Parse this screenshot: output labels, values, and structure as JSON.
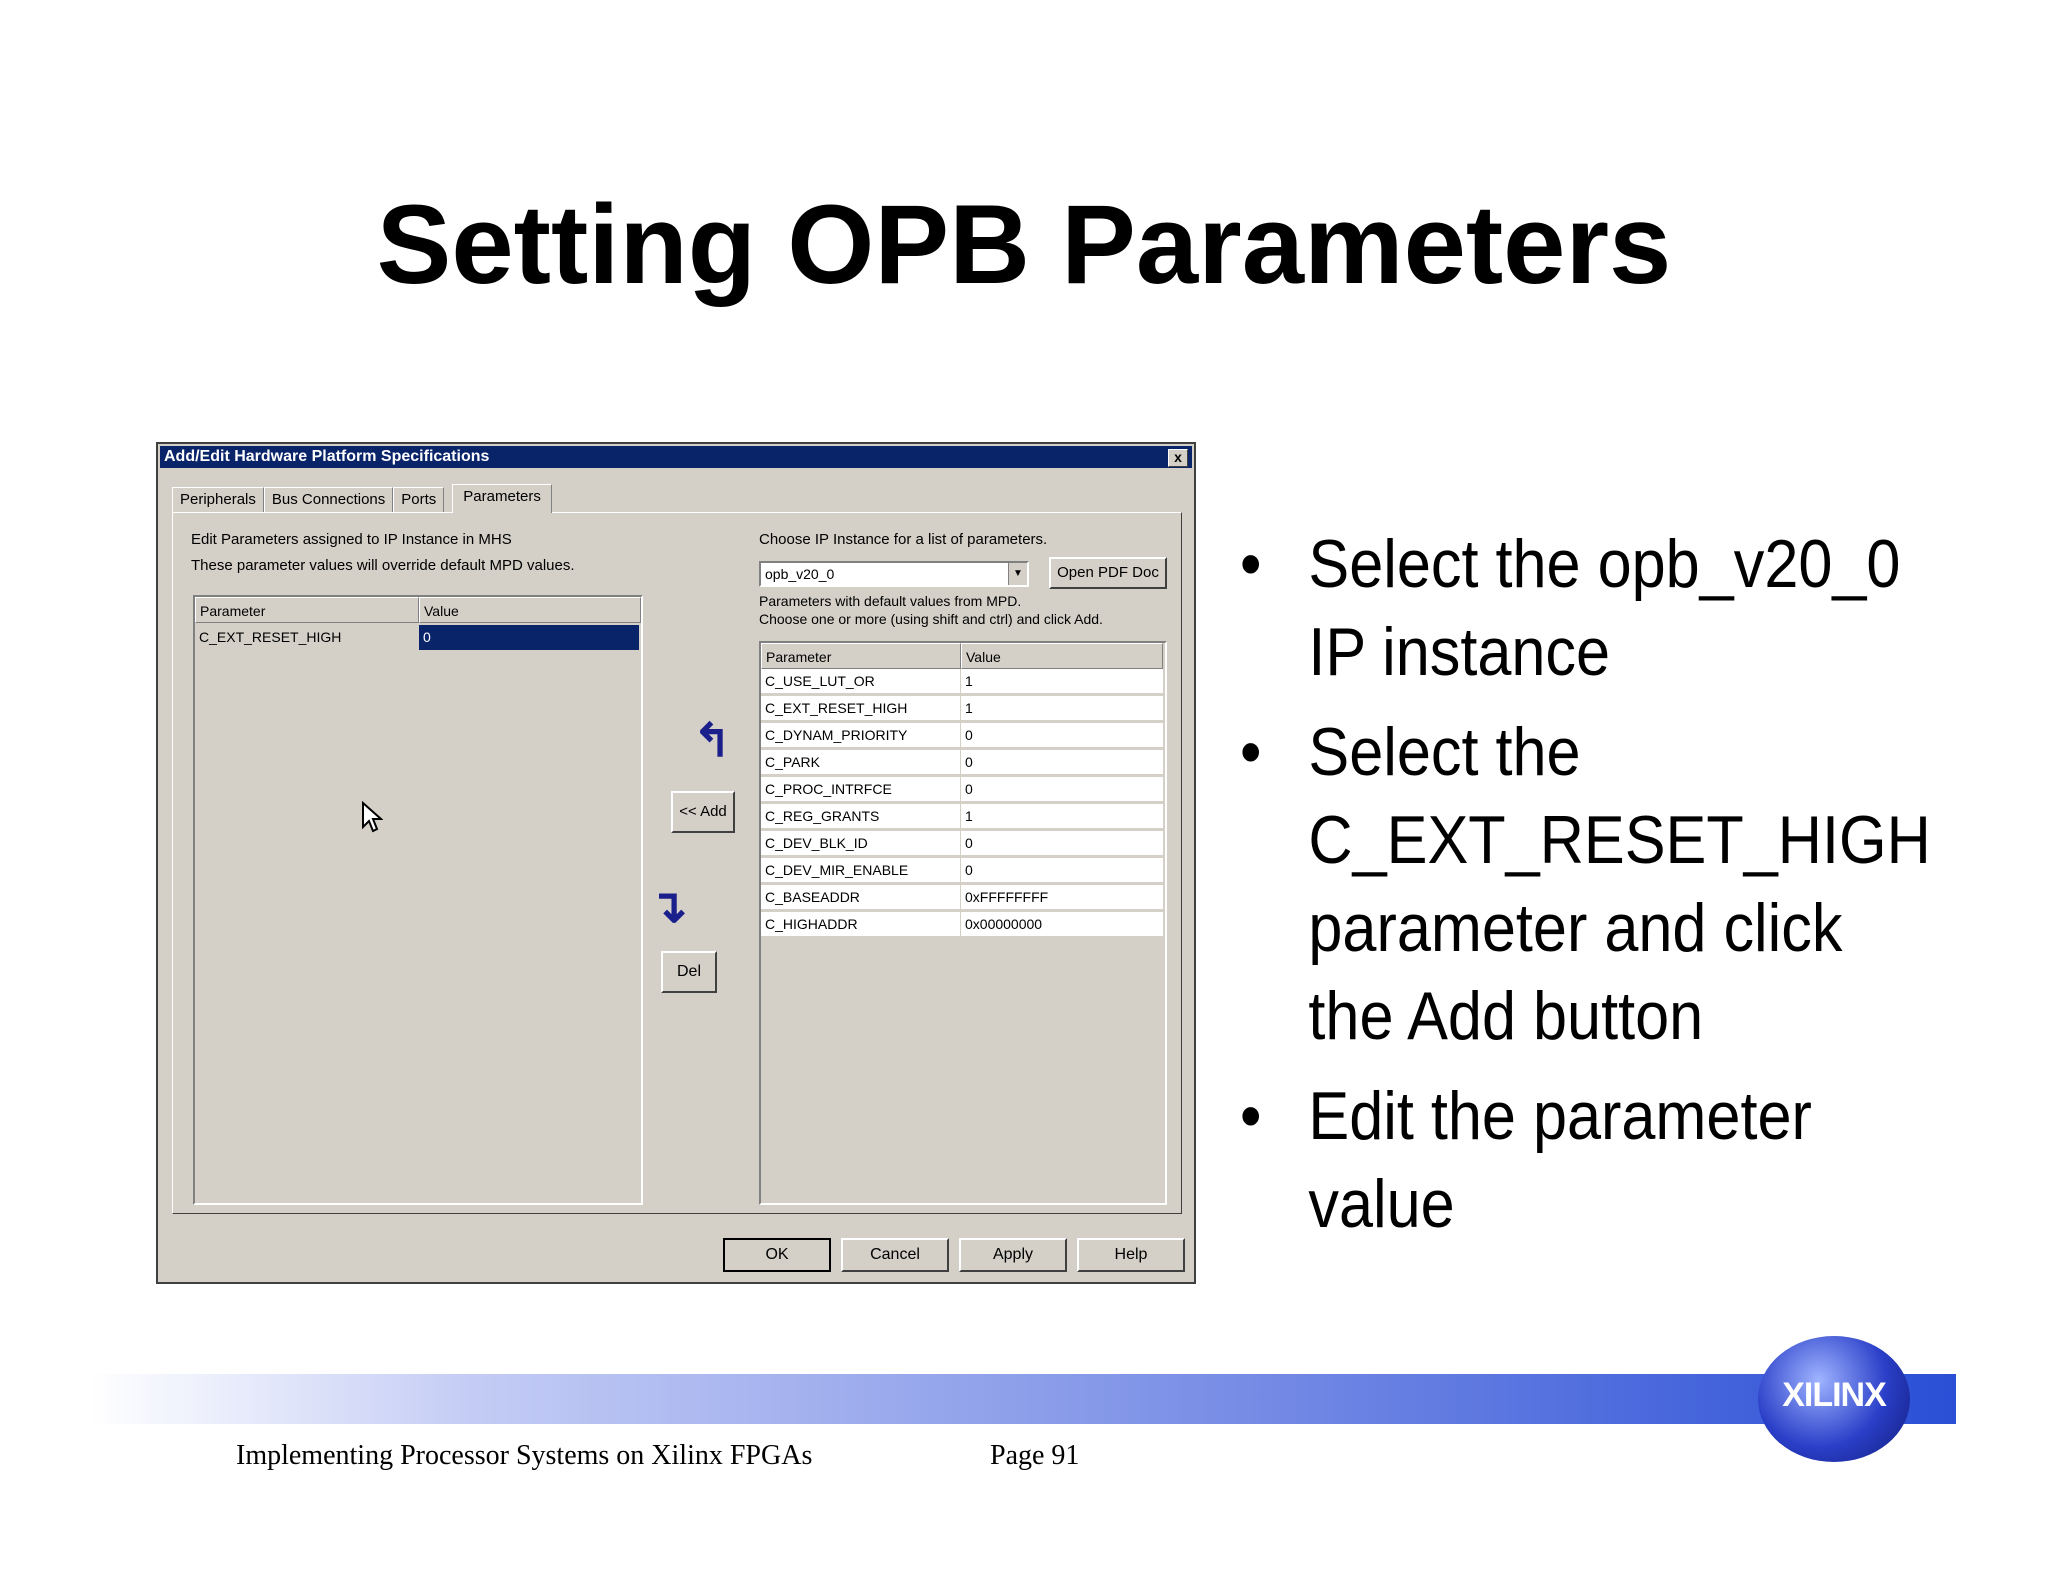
{
  "slide": {
    "title": "Setting OPB Parameters"
  },
  "dialog": {
    "title": "Add/Edit Hardware Platform Specifications",
    "close_label": "x",
    "tabs": [
      "Peripherals",
      "Bus Connections",
      "Ports",
      "Parameters"
    ],
    "active_tab": "Parameters",
    "left_desc_line1": "Edit Parameters assigned to IP Instance in MHS",
    "left_desc_line2": "These parameter values will override default MPD values.",
    "left_table": {
      "headers": [
        "Parameter",
        "Value"
      ],
      "rows": [
        [
          "C_EXT_RESET_HIGH",
          "0"
        ]
      ]
    },
    "right_choose_label": "Choose IP Instance for a list of parameters.",
    "ip_instance": "opb_v20_0",
    "open_pdf_label": "Open PDF Doc",
    "right_desc_line1": "Parameters with default values from MPD.",
    "right_desc_line2": "Choose one or more (using shift and ctrl) and click Add.",
    "right_table": {
      "headers": [
        "Parameter",
        "Value"
      ],
      "rows": [
        [
          "C_USE_LUT_OR",
          "1"
        ],
        [
          "C_EXT_RESET_HIGH",
          "1"
        ],
        [
          "C_DYNAM_PRIORITY",
          "0"
        ],
        [
          "C_PARK",
          "0"
        ],
        [
          "C_PROC_INTRFCE",
          "0"
        ],
        [
          "C_REG_GRANTS",
          "1"
        ],
        [
          "C_DEV_BLK_ID",
          "0"
        ],
        [
          "C_DEV_MIR_ENABLE",
          "0"
        ],
        [
          "C_BASEADDR",
          "0xFFFFFFFF"
        ],
        [
          "C_HIGHADDR",
          "0x00000000"
        ]
      ]
    },
    "add_label": "<< Add",
    "del_label": "Del",
    "ok_label": "OK",
    "cancel_label": "Cancel",
    "apply_label": "Apply",
    "help_label": "Help"
  },
  "bullets": [
    "Select the opb_v20_0 IP instance",
    "Select the C_EXT_RESET_HIGH parameter and click the Add button",
    "Edit the parameter value"
  ],
  "footer": {
    "course": "Implementing Processor Systems on Xilinx FPGAs",
    "page": "Page 91",
    "logo": "XILINX"
  }
}
